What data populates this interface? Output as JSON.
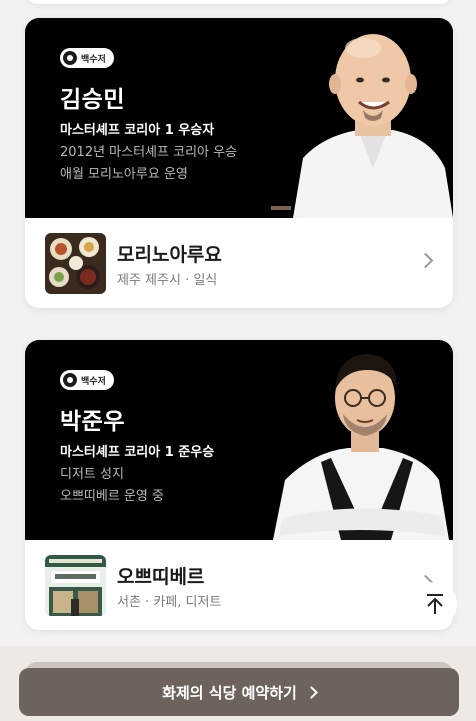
{
  "cards": [
    {
      "badge": "백수저",
      "chef_name": "김승민",
      "desc_1": "마스터셰프 코리아 1 우승자",
      "desc_2": "2012년 마스터셰프 코리아 우승",
      "desc_3": "애월 모리노아루요 운영",
      "restaurant_name": "모리노아루요",
      "restaurant_meta": "제주 제주시 · 일식"
    },
    {
      "badge": "백수저",
      "chef_name": "박준우",
      "desc_1": "마스터셰프 코리아 1 준우승",
      "desc_2": "디저트 성지",
      "desc_3": "오쁘띠베르 운영 중",
      "restaurant_name": "오쁘띠베르",
      "restaurant_meta": "서촌 · 카페, 디저트"
    }
  ],
  "cta": {
    "label": "화제의 식당 예약하기"
  },
  "icons": {
    "badge": "spoon-badge-icon",
    "row_chevron": "chevron-right-icon",
    "scroll_top": "arrow-up-to-top-icon"
  },
  "colors": {
    "hero_bg": "#000000",
    "cta_bg": "#6e625d",
    "bottom_bar_bg": "#efe9e5"
  }
}
